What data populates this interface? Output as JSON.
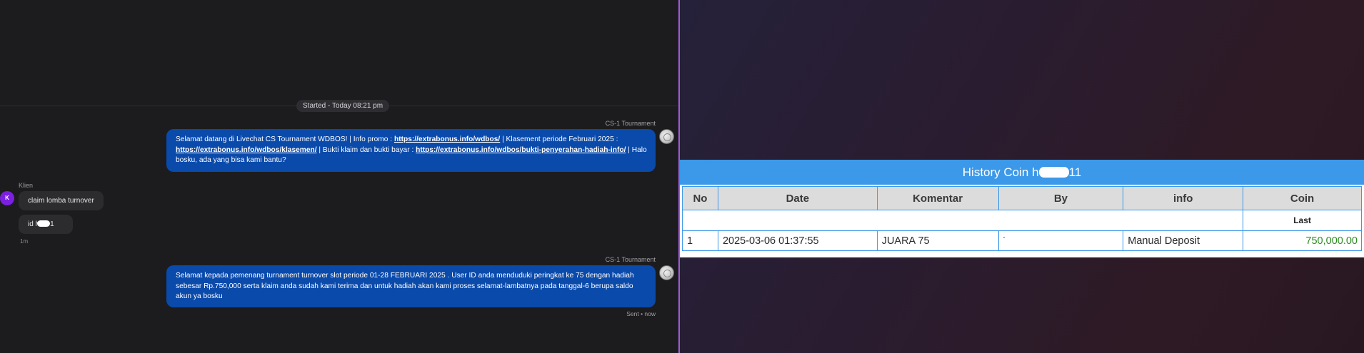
{
  "chat": {
    "started_label": "Started - Today 08:21 pm",
    "messages": [
      {
        "sender": "CS-1 Tournament",
        "parts": {
          "t1": "Selamat datang di Livechat CS Tournament WDBOS! | Info promo : ",
          "l1": "https://extrabonus.info/wdbos/",
          "t2": " | Klasement periode Februari 2025 : ",
          "l2": "https://extrabonus.info/wdbos/klasemen/",
          "t3": " | Bukti klaim dan bukti bayar : ",
          "l3": "https://extrabonus.info/wdbos/bukti-penyerahan-hadiah-info/",
          "t4": " | Halo bosku, ada yang bisa kami bantu?"
        }
      },
      {
        "sender": "Klien",
        "avatar_letter": "K",
        "texts": [
          "claim lomba turnover"
        ],
        "id_prefix": "id h",
        "id_suffix": "1",
        "time": "1m"
      },
      {
        "sender": "CS-1 Tournament",
        "text": "Selamat kepada pemenang turnament turnover slot periode 01-28 FEBRUARI 2025 . User ID anda menduduki peringkat ke 75 dengan hadiah sebesar Rp.750,000 serta klaim anda sudah kami terima dan untuk hadiah akan kami proses selamat-lambatnya pada tanggal-6 berupa saldo akun ya bosku",
        "status": "Sent • now"
      }
    ]
  },
  "history": {
    "title_prefix": "History Coin h",
    "title_suffix": "11",
    "columns": [
      "No",
      "Date",
      "Komentar",
      "By",
      "info",
      "Coin"
    ],
    "last_label": "Last",
    "rows": [
      {
        "no": "1",
        "date": "2025-03-06 01:37:55",
        "komentar": "JUARA 75",
        "by": "",
        "info": "Manual Deposit",
        "coin": "750,000.00"
      }
    ]
  },
  "colors": {
    "agent_bubble": "#0a4aab",
    "client_avatar": "#7b20e0",
    "table_header": "#3c98e8",
    "coin_text": "#2e8b23",
    "separator": "#9f5ad8"
  }
}
